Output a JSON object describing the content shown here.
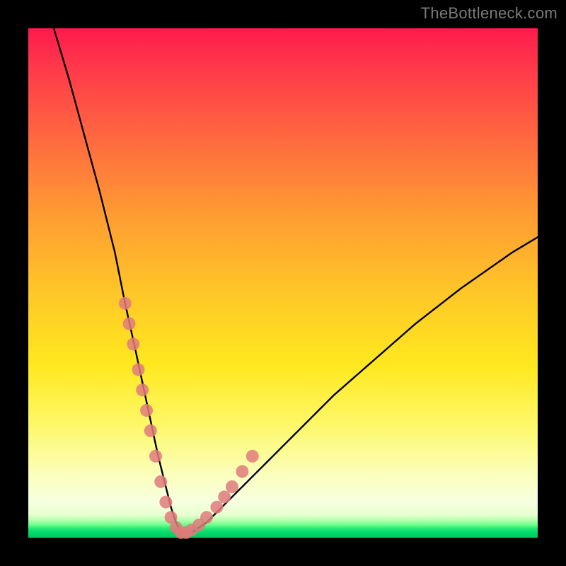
{
  "watermark": "TheBottleneck.com",
  "chart_data": {
    "type": "line",
    "title": "",
    "xlabel": "",
    "ylabel": "",
    "xlim": [
      0,
      100
    ],
    "ylim": [
      0,
      100
    ],
    "grid": false,
    "legend": false,
    "series": [
      {
        "name": "bottleneck-curve",
        "x": [
          5,
          8,
          11,
          14,
          17,
          19,
          21,
          22.5,
          24,
          25.5,
          27,
          28,
          29,
          30,
          32,
          35,
          40,
          46,
          53,
          60,
          68,
          76,
          85,
          95,
          100
        ],
        "y": [
          100,
          90,
          79,
          68,
          56,
          46,
          37,
          30,
          23,
          16,
          10,
          6,
          3,
          1,
          1,
          3,
          8,
          14,
          21,
          28,
          35,
          42,
          49,
          56,
          59
        ]
      }
    ],
    "markers": {
      "name": "highlight-dots",
      "color": "#e07a7d",
      "radius_px": 9,
      "points_xy": [
        [
          19.0,
          46
        ],
        [
          19.8,
          42
        ],
        [
          20.6,
          38
        ],
        [
          21.6,
          33
        ],
        [
          22.4,
          29
        ],
        [
          23.2,
          25
        ],
        [
          24.0,
          21
        ],
        [
          25.0,
          16
        ],
        [
          26.0,
          11
        ],
        [
          27.0,
          7
        ],
        [
          28.0,
          4
        ],
        [
          29.0,
          2
        ],
        [
          30.0,
          1
        ],
        [
          31.0,
          1
        ],
        [
          32.0,
          1.5
        ],
        [
          33.5,
          2.5
        ],
        [
          35.0,
          4
        ],
        [
          37.0,
          6
        ],
        [
          38.5,
          8
        ],
        [
          40.0,
          10
        ],
        [
          42.0,
          13
        ],
        [
          44.0,
          16
        ]
      ]
    },
    "background_gradient": {
      "orientation": "vertical",
      "stops": [
        {
          "pos": 0.0,
          "color": "#ff1a4d"
        },
        {
          "pos": 0.36,
          "color": "#ff9a33"
        },
        {
          "pos": 0.66,
          "color": "#ffe81e"
        },
        {
          "pos": 0.93,
          "color": "#f6ffe0"
        },
        {
          "pos": 1.0,
          "color": "#00c85f"
        }
      ]
    }
  }
}
